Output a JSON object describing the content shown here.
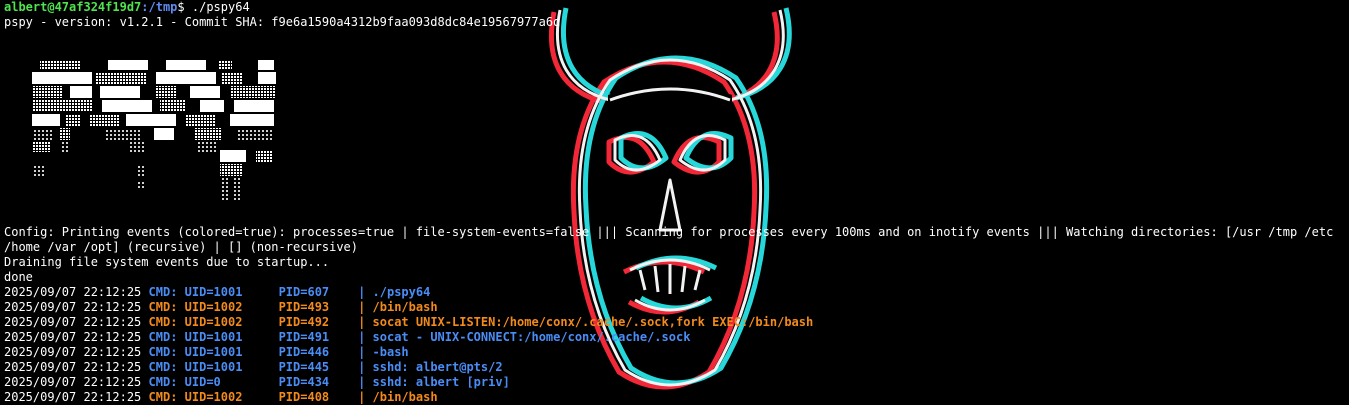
{
  "prompt": {
    "user_host": "albert@47af324f19d7",
    "path": ":/tmp",
    "symbol": "$",
    "command": " ./pspy64"
  },
  "version_line": "pspy - version: v1.2.1 - Commit SHA: f9e6a1590a4312b9faa093d8dc84e19567977a6d",
  "config_line": "Config: Printing events (colored=true): processes=true | file-system-events=false ||| Scanning for processes every 100ms and on inotify events ||| Watching directories: [/usr /tmp /etc /home /var /opt] (recursive) | [] (non-recursive)",
  "draining_line": "Draining file system events due to startup...",
  "done_line": "done",
  "events": [
    {
      "ts": "2025/09/07 22:12:25",
      "uid": "UID=1001",
      "pid": "PID=607",
      "cmd": "./pspy64",
      "color": "#4a8df5"
    },
    {
      "ts": "2025/09/07 22:12:25",
      "uid": "UID=1002",
      "pid": "PID=493",
      "cmd": "/bin/bash",
      "color": "#f28a1c"
    },
    {
      "ts": "2025/09/07 22:12:25",
      "uid": "UID=1002",
      "pid": "PID=492",
      "cmd": "socat UNIX-LISTEN:/home/conx/.cache/.sock,fork EXEC:/bin/bash",
      "color": "#f28a1c"
    },
    {
      "ts": "2025/09/07 22:12:25",
      "uid": "UID=1001",
      "pid": "PID=491",
      "cmd": "socat - UNIX-CONNECT:/home/conx/.cache/.sock",
      "color": "#4a8df5"
    },
    {
      "ts": "2025/09/07 22:12:25",
      "uid": "UID=1001",
      "pid": "PID=446",
      "cmd": "-bash",
      "color": "#4a8df5"
    },
    {
      "ts": "2025/09/07 22:12:25",
      "uid": "UID=1001",
      "pid": "PID=445",
      "cmd": "sshd: albert@pts/2",
      "color": "#4a8df5"
    },
    {
      "ts": "2025/09/07 22:12:25",
      "uid": "UID=0",
      "pid": "PID=434",
      "cmd": "sshd: albert [priv]",
      "color": "#4a8df5"
    },
    {
      "ts": "2025/09/07 22:12:25",
      "uid": "UID=1002",
      "pid": "PID=408",
      "cmd": "/bin/bash",
      "color": "#f28a1c"
    }
  ],
  "labels": {
    "cmd": "CMD:",
    "sep": "|"
  },
  "colors": {
    "uid1001": "#4a8df5",
    "uid1002": "#f28a1c",
    "prompt_user": "#4fe34f",
    "prompt_path": "#5d8df0"
  },
  "icons": {
    "logo": "pspy-ascii-logo",
    "background": "oni-mask-image"
  }
}
